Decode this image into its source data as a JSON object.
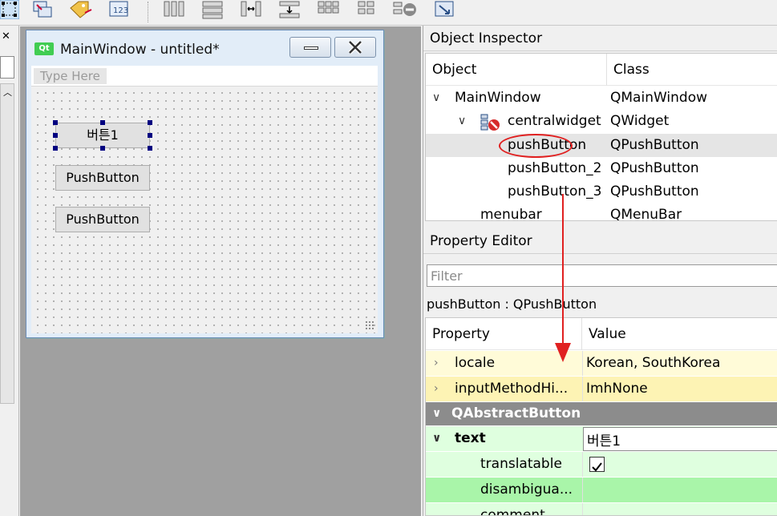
{
  "toolbar": {
    "icons": [
      "edit-widgets-icon",
      "edit-signals-icon",
      "edit-buddies-icon",
      "edit-tab-order-icon",
      "layout-horizontal-icon",
      "layout-vertical-icon",
      "layout-horizontal-splitter-icon",
      "layout-vertical-splitter-icon",
      "layout-grid-icon",
      "layout-form-icon",
      "break-layout-icon",
      "adjust-size-icon"
    ]
  },
  "form_window": {
    "badge": "Qt",
    "title": "MainWindow - untitled*",
    "menu_placeholder": "Type Here",
    "buttons": [
      {
        "label": "버튼1"
      },
      {
        "label": "PushButton"
      },
      {
        "label": "PushButton"
      }
    ]
  },
  "object_inspector": {
    "title": "Object Inspector",
    "columns": {
      "object": "Object",
      "class": "Class"
    },
    "rows": [
      {
        "name": "MainWindow",
        "class": "QMainWindow",
        "expanded": true
      },
      {
        "name": "centralwidget",
        "class": "QWidget",
        "expanded": true
      },
      {
        "name": "pushButton",
        "class": "QPushButton",
        "selected": true
      },
      {
        "name": "pushButton_2",
        "class": "QPushButton"
      },
      {
        "name": "pushButton_3",
        "class": "QPushButton"
      },
      {
        "name": "menubar",
        "class": "QMenuBar"
      }
    ]
  },
  "property_editor": {
    "title": "Property Editor",
    "filter_placeholder": "Filter",
    "object_label": "pushButton : QPushButton",
    "columns": {
      "property": "Property",
      "value": "Value"
    },
    "rows": [
      {
        "name": "locale",
        "value": "Korean, SouthKorea"
      },
      {
        "name": "inputMethodHi...",
        "value": "ImhNone"
      },
      {
        "name": "QAbstractButton"
      },
      {
        "name": "text",
        "value": "버튼1"
      },
      {
        "name": "translatable",
        "checked": true
      },
      {
        "name": "disambigua...",
        "value": ""
      },
      {
        "name": "comment",
        "value": ""
      }
    ]
  },
  "colors": {
    "selection_handle": "#000080",
    "highlight_annotation": "#e02020",
    "property_yellow": "#fffbd8",
    "property_green": "#a9f5a9",
    "section_gray": "#8c8c8c"
  }
}
